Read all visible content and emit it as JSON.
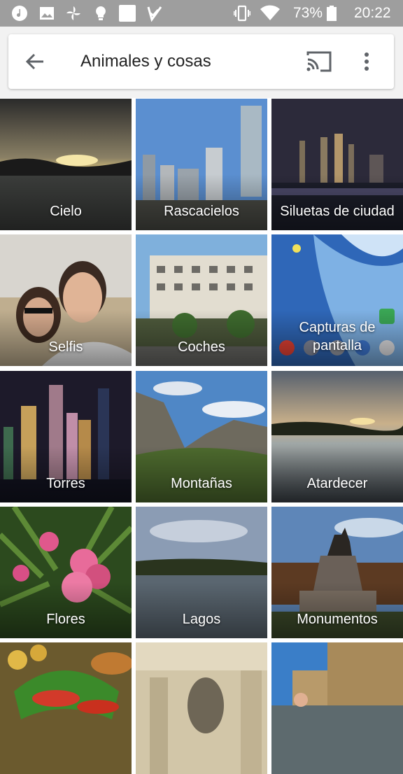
{
  "status_bar": {
    "battery_percent": "73%",
    "time": "20:22",
    "icons": [
      "music-icon",
      "image-icon",
      "pinwheel-icon",
      "bulb-icon",
      "square-icon",
      "check-badge-icon",
      "vibrate-icon",
      "wifi-icon",
      "battery-icon"
    ]
  },
  "app_bar": {
    "title": "Animales y cosas",
    "back_icon": "arrow-back-icon",
    "cast_icon": "cast-icon",
    "more_icon": "more-vertical-icon"
  },
  "categories": [
    {
      "label": "Cielo"
    },
    {
      "label": "Rascacielos"
    },
    {
      "label": "Siluetas de ciudad"
    },
    {
      "label": "Selfis"
    },
    {
      "label": "Coches"
    },
    {
      "label": "Capturas de pantalla"
    },
    {
      "label": "Torres"
    },
    {
      "label": "Montañas"
    },
    {
      "label": "Atardecer"
    },
    {
      "label": "Flores"
    },
    {
      "label": "Lagos"
    },
    {
      "label": "Monumentos"
    },
    {
      "label": ""
    },
    {
      "label": ""
    },
    {
      "label": ""
    }
  ],
  "colors": {
    "status_bar": "#9e9e9e",
    "app_bar_bg": "#f2f2f2",
    "title_text": "#222222",
    "icon_gray": "#5f6368"
  }
}
